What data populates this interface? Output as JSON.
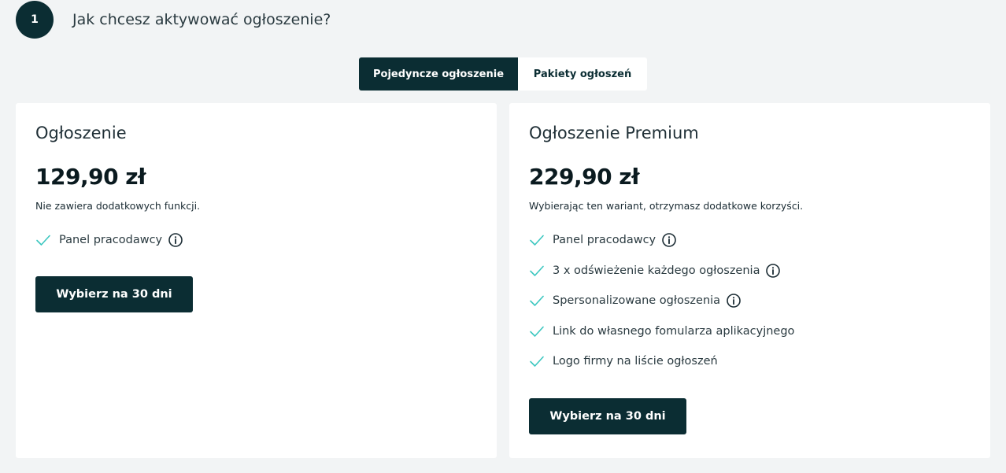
{
  "step": {
    "number": "1",
    "title": "Jak chcesz aktywować ogłoszenie?"
  },
  "tabs": [
    {
      "label": "Pojedyncze ogłoszenie",
      "active": true
    },
    {
      "label": "Pakiety ogłoszeń",
      "active": false
    }
  ],
  "plans": [
    {
      "title": "Ogłoszenie",
      "price": "129,90 zł",
      "description": "Nie zawiera dodatkowych funkcji.",
      "features": [
        {
          "label": "Panel pracodawcy",
          "info": true
        }
      ],
      "button_label": "Wybierz na 30 dni"
    },
    {
      "title": "Ogłoszenie Premium",
      "price": "229,90 zł",
      "description": "Wybierając ten wariant, otrzymasz dodatkowe korzyści.",
      "features": [
        {
          "label": "Panel pracodawcy",
          "info": true
        },
        {
          "label": "3 x odświeżenie każdego ogłoszenia",
          "info": true
        },
        {
          "label": "Spersonalizowane ogłoszenia",
          "info": true
        },
        {
          "label": "Link do własnego fomularza aplikacyjnego",
          "info": false
        },
        {
          "label": "Logo firmy na liście ogłoszeń",
          "info": false
        }
      ],
      "button_label": "Wybierz na 30 dni"
    }
  ],
  "colors": {
    "primary": "#0b2d33",
    "check": "#3cc7c0",
    "background": "#f2f4f5",
    "card": "#ffffff"
  },
  "icons": {
    "check": "check-icon",
    "info": "info-icon"
  }
}
